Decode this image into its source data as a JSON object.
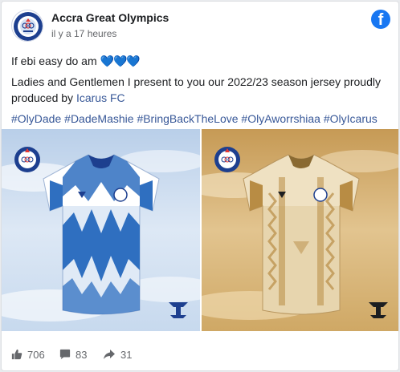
{
  "post": {
    "page_name": "Accra Great Olympics",
    "timestamp": "il y a 17 heures",
    "line1": "If ebi easy do am",
    "hearts": "💙💙💙",
    "line2": "Ladies and Gentlemen I present to you our 2022/23 season jersey proudly",
    "line3_prefix": "produced by",
    "line3_link": "Icarus FC",
    "hashtags": [
      "#OlyDade",
      "#DadeMashie",
      "#BringBackTheLove",
      "#OlyAworrshiaa",
      "#OlyIcarus"
    ]
  },
  "photos": [
    {
      "name": "blue-white-jersey",
      "kit_color": "#2f6fc0",
      "background": "#cfe0f2"
    },
    {
      "name": "gold-cream-jersey",
      "kit_color": "#e8d8b4",
      "background": "#d8b87a"
    }
  ],
  "stats": {
    "likes": "706",
    "comments": "83",
    "shares": "31"
  },
  "icons": {
    "brand": "facebook-icon",
    "like": "thumbs-up-icon",
    "comment": "comment-icon",
    "share": "share-icon"
  },
  "colors": {
    "link": "#385898",
    "facebook_blue": "#1877f2",
    "muted": "#65676b"
  }
}
